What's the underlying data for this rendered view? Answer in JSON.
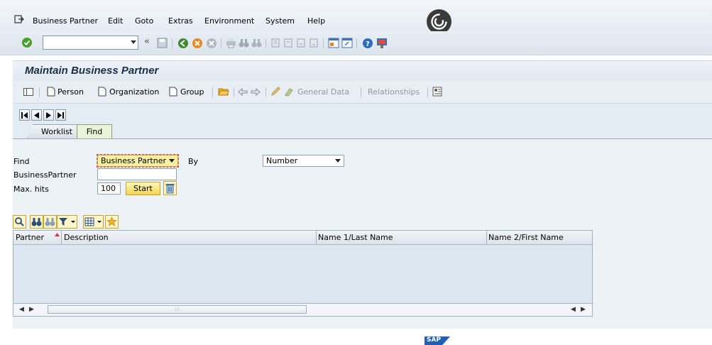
{
  "menu": {
    "items": [
      "Business Partner",
      "Edit",
      "Goto",
      "Extras",
      "Environment",
      "System",
      "Help"
    ]
  },
  "title": "Maintain Business Partner",
  "app_toolbar": {
    "person": "Person",
    "organization": "Organization",
    "group": "Group",
    "general_data": "General Data",
    "relationships": "Relationships"
  },
  "tabs": {
    "worklist": "Worklist",
    "find": "Find"
  },
  "search": {
    "find_label": "Find",
    "find_value": "Business Partner",
    "by_label": "By",
    "by_value": "Number",
    "bp_label": "BusinessPartner",
    "bp_value": "",
    "maxhits_label": "Max. hits",
    "maxhits_value": "100",
    "start_label": "Start"
  },
  "grid": {
    "columns": [
      "Partner",
      "Description",
      "Name 1/Last Name",
      "Name 2/First Name"
    ],
    "rows": []
  },
  "footer": {
    "logo": "SAP"
  },
  "colors": {
    "accent_yellow": "#f0d64a",
    "find_tab": "#e8f3d8",
    "title_text": "#1c2e44"
  }
}
